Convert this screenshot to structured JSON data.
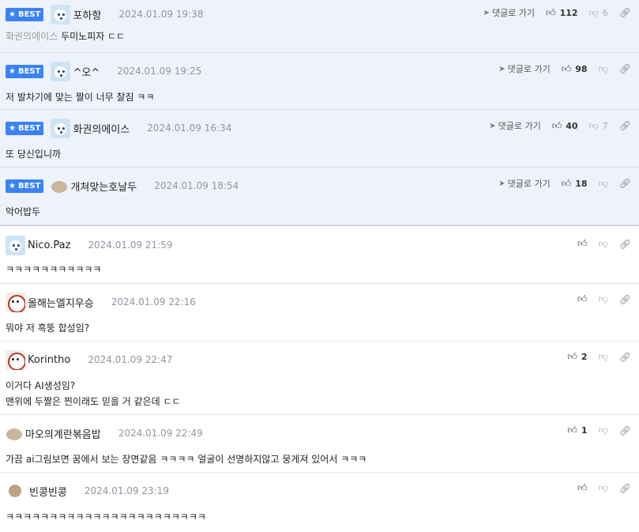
{
  "best_badge": "BEST",
  "goto_label": "댓글로 가기",
  "comments": [
    {
      "nick": "포하항",
      "date": "2024.01.09 19:38",
      "prefix": "화권의에이스",
      "text": "두미노피자 ㄷㄷ",
      "up": "112",
      "down": "6",
      "avatar": "dog-icon"
    },
    {
      "nick": "^오^",
      "date": "2024.01.09 19:25",
      "text": "저 발차기에 맞는 짤이 너무 찰짐 ㅋㅋ",
      "up": "98",
      "down": "",
      "avatar": "dog-icon"
    },
    {
      "nick": "화권의에이스",
      "date": "2024.01.09 16:34",
      "text": "또 당신입니까",
      "up": "40",
      "down": "7",
      "avatar": "dog-icon"
    },
    {
      "nick": "개쳐맞는호날두",
      "date": "2024.01.09 18:54",
      "text": "악어밥두",
      "up": "18",
      "down": "",
      "avatar": "potato-icon"
    },
    {
      "nick": "Nico.Paz",
      "date": "2024.01.09 21:59",
      "text": "ㅋㅋㅋㅋㅋㅋㅋㅋㅋㅋㅋ",
      "up": "",
      "down": "",
      "avatar": "dog-icon"
    },
    {
      "nick": "올해는엘지우승",
      "date": "2024.01.09 22:16",
      "text": "뭐야 저 흑뚱 합성임?",
      "up": "",
      "down": "",
      "avatar": "panda-icon"
    },
    {
      "nick": "Korintho",
      "date": "2024.01.09 22:47",
      "text": "이거다 AI생성임?",
      "text2": "맨위에 두짤은 찐이래도 믿을 거 같은데 ㄷㄷ",
      "up": "2",
      "down": "",
      "avatar": "panda-icon"
    },
    {
      "nick": "마오의계란볶음밥",
      "date": "2024.01.09 22:49",
      "text": "가끔 ai그림보면 꿈에서 보는 장면같음 ㅋㅋㅋㅋ 얼굴이 선명하지않고 뭉게져 있어서 ㅋㅋㅋ",
      "up": "1",
      "down": "",
      "avatar": "potato-icon"
    },
    {
      "nick": "빈콩빈콩",
      "date": "2024.01.09 23:19",
      "text": "ㅋㅋㅋㅋㅋㅋㅋㅋㅋㅋㅋㅋㅋㅋㅋㅋㅋㅋㅋㅋㅋㅋㅋ",
      "up": "",
      "down": "",
      "avatar": "bean-icon"
    }
  ]
}
